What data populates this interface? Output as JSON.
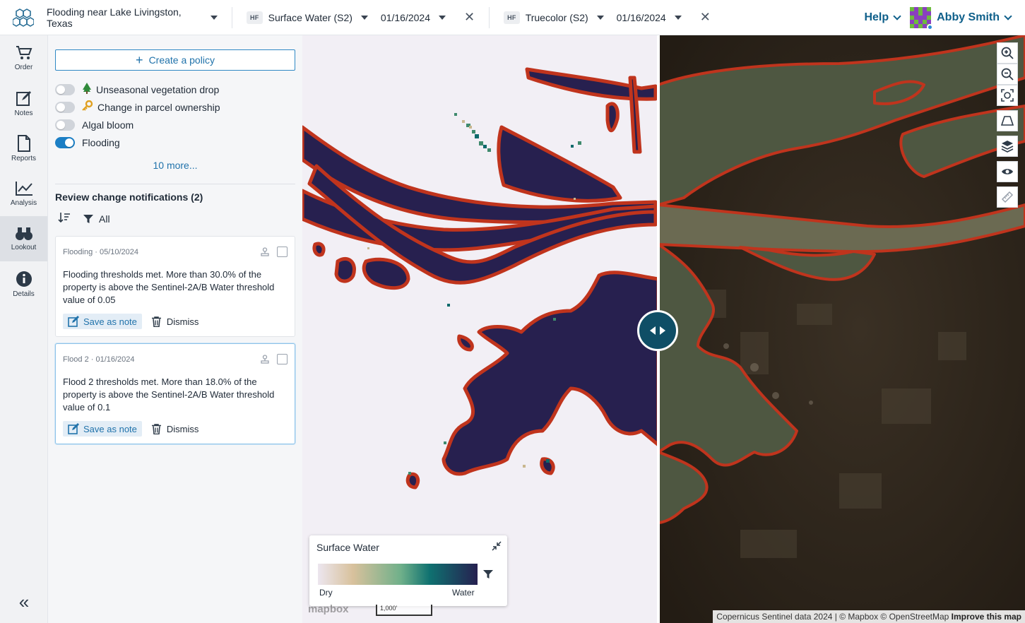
{
  "topbar": {
    "project": "Flooding near Lake Livingston, Texas",
    "layers": [
      {
        "badge": "HF",
        "name": "Surface Water (S2)",
        "date": "01/16/2024"
      },
      {
        "badge": "HF",
        "name": "Truecolor (S2)",
        "date": "01/16/2024"
      }
    ],
    "help": "Help",
    "user": "Abby Smith"
  },
  "rail": [
    {
      "label": "Order",
      "icon": "cart-icon"
    },
    {
      "label": "Notes",
      "icon": "note-edit-icon"
    },
    {
      "label": "Reports",
      "icon": "document-icon"
    },
    {
      "label": "Analysis",
      "icon": "line-chart-icon"
    },
    {
      "label": "Lookout",
      "icon": "binoculars-icon",
      "active": true
    },
    {
      "label": "Details",
      "icon": "info-icon"
    }
  ],
  "panel": {
    "create_label": "Create a policy",
    "policies": [
      {
        "label": "Unseasonal vegetation drop",
        "icon": "tree-icon",
        "on": false
      },
      {
        "label": "Change in parcel ownership",
        "icon": "key-icon",
        "on": false
      },
      {
        "label": "Algal bloom",
        "on": false
      },
      {
        "label": "Flooding",
        "on": true
      }
    ],
    "more_link": "10 more...",
    "review_title": "Review change notifications (2)",
    "filter_label": "All",
    "notifications": [
      {
        "header": "Flooding · 05/10/2024",
        "body": "Flooding thresholds met. More than 30.0% of the property is above the Sentinel-2A/B Water threshold value of 0.05",
        "save_label": "Save as note",
        "dismiss_label": "Dismiss"
      },
      {
        "header": "Flood 2 · 01/16/2024",
        "body": "Flood 2 thresholds met. More than 18.0% of the property is above the Sentinel-2A/B Water threshold value of 0.1",
        "save_label": "Save as note",
        "dismiss_label": "Dismiss"
      }
    ]
  },
  "map": {
    "legend": {
      "title": "Surface Water",
      "min_label": "Dry",
      "max_label": "Water"
    },
    "mapbox": "mapbox",
    "scale": "1,000'",
    "attribution": "Copernicus Sentinel data 2024 | © Mapbox © OpenStreetMap",
    "improve": "Improve this map",
    "colors": {
      "water": "#27204f",
      "outline": "#c0341d",
      "dry": "#f2eff5"
    }
  }
}
